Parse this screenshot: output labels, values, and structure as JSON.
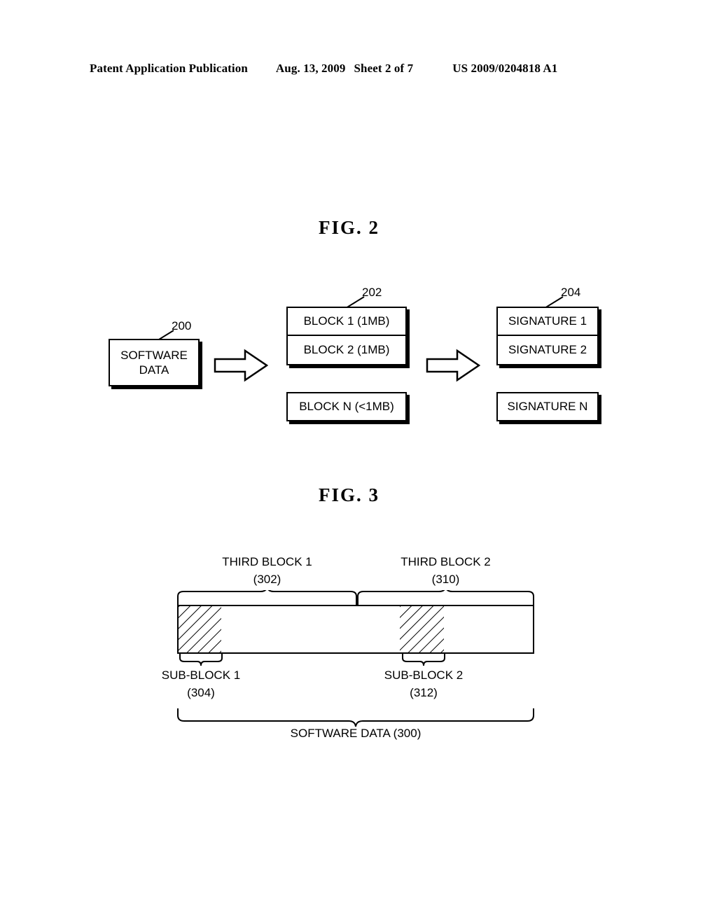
{
  "header": {
    "publication": "Patent Application Publication",
    "date": "Aug. 13, 2009",
    "sheet": "Sheet 2 of 7",
    "patent_number": "US 2009/0204818 A1"
  },
  "figures": [
    {
      "title": "FIG.  2",
      "software_data_box": {
        "label": "SOFTWARE\nDATA",
        "ref": "200"
      },
      "block_group": {
        "ref": "202",
        "cells": [
          {
            "label": "BLOCK 1 (1MB)"
          },
          {
            "label": "BLOCK 2 (1MB)"
          }
        ],
        "separate_cell": {
          "label": "BLOCK N (<1MB)"
        }
      },
      "signature_group": {
        "ref": "204",
        "cells": [
          {
            "label": "SIGNATURE 1"
          },
          {
            "label": "SIGNATURE 2"
          }
        ],
        "separate_cell": {
          "label": "SIGNATURE N"
        }
      },
      "arrows": [
        {
          "name": "arrow-data-to-blocks"
        },
        {
          "name": "arrow-blocks-to-signatures"
        }
      ]
    },
    {
      "title": "FIG.  3",
      "top_labels": [
        {
          "name": "THIRD BLOCK 1",
          "ref": "(302)"
        },
        {
          "name": "THIRD BLOCK 2",
          "ref": "(310)"
        }
      ],
      "sub_labels": [
        {
          "name": "SUB-BLOCK 1",
          "ref": "(304)"
        },
        {
          "name": "SUB-BLOCK 2",
          "ref": "(312)"
        }
      ],
      "bottom_label": "SOFTWARE DATA (300)",
      "bar": {
        "cell_count": 8,
        "hatched_cells": [
          1,
          6
        ]
      }
    }
  ],
  "colors": {
    "ink": "#000000",
    "paper": "#ffffff"
  }
}
